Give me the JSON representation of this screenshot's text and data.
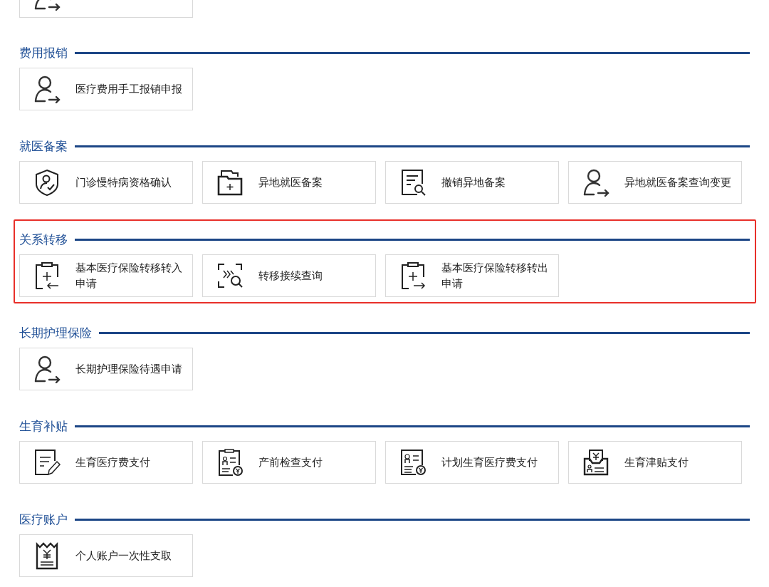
{
  "top_partial_card": {
    "kind": "person"
  },
  "sections": [
    {
      "title": "费用报销",
      "highlighted": false,
      "items": [
        {
          "label": "医疗费用手工报销申报",
          "kind": "person"
        }
      ]
    },
    {
      "title": "就医备案",
      "highlighted": false,
      "items": [
        {
          "label": "门诊慢特病资格确认",
          "kind": "shield"
        },
        {
          "label": "异地就医备案",
          "kind": "folder"
        },
        {
          "label": "撤销异地备案",
          "kind": "docsearch"
        },
        {
          "label": "异地就医备案查询变更",
          "kind": "person"
        }
      ]
    },
    {
      "title": "关系转移",
      "highlighted": true,
      "items": [
        {
          "label": "基本医疗保险转移转入申请",
          "kind": "clipin"
        },
        {
          "label": "转移接续查询",
          "kind": "scan"
        },
        {
          "label": "基本医疗保险转移转出申请",
          "kind": "clipout"
        }
      ]
    },
    {
      "title": "长期护理保险",
      "highlighted": false,
      "items": [
        {
          "label": "长期护理保险待遇申请",
          "kind": "person"
        }
      ]
    },
    {
      "title": "生育补贴",
      "highlighted": false,
      "items": [
        {
          "label": "生育医疗费支付",
          "kind": "docpen"
        },
        {
          "label": "产前检查支付",
          "kind": "clipyen"
        },
        {
          "label": "计划生育医疗费支付",
          "kind": "formyen"
        },
        {
          "label": "生育津贴支付",
          "kind": "trayyen"
        }
      ]
    },
    {
      "title": "医疗账户",
      "highlighted": false,
      "items": [
        {
          "label": "个人账户一次性支取",
          "kind": "receipt"
        }
      ]
    }
  ]
}
